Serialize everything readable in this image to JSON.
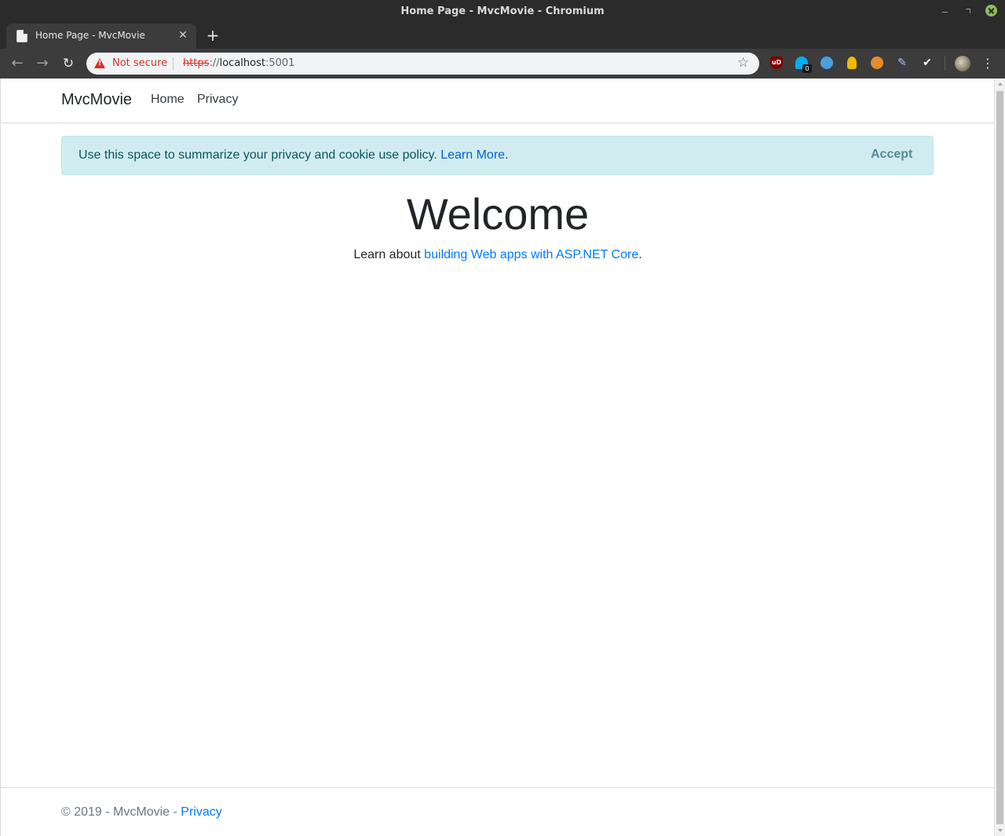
{
  "window": {
    "title": "Home Page - MvcMovie - Chromium"
  },
  "tab": {
    "title": "Home Page - MvcMovie",
    "close_glyph": "✕",
    "new_tab_glyph": "+"
  },
  "toolbar": {
    "back_glyph": "←",
    "forward_glyph": "→",
    "reload_glyph": "↻",
    "security_label": "Not secure",
    "url_scheme": "https",
    "url_sep": "://",
    "url_host": "localhost",
    "url_port": ":5001",
    "star_glyph": "☆",
    "menu_glyph": "⋮",
    "extensions": [
      {
        "name": "ublock",
        "label": "uD"
      },
      {
        "name": "ghostery",
        "label": "",
        "badge": "0"
      },
      {
        "name": "compass",
        "label": ""
      },
      {
        "name": "bulb",
        "label": ""
      },
      {
        "name": "cookie",
        "label": ""
      },
      {
        "name": "pen",
        "label": "✎"
      },
      {
        "name": "checkmark",
        "label": "✔"
      }
    ]
  },
  "site": {
    "brand": "MvcMovie",
    "nav": {
      "home": "Home",
      "privacy": "Privacy"
    },
    "cookie": {
      "text": "Use this space to summarize your privacy and cookie use policy. ",
      "link": "Learn More",
      "period": ".",
      "accept": "Accept"
    },
    "heading": "Welcome",
    "learn": {
      "prefix": "Learn about ",
      "link": "building Web apps with ASP.NET Core",
      "suffix": "."
    },
    "footer": {
      "text": "© 2019 - MvcMovie - ",
      "link": "Privacy"
    }
  },
  "colors": {
    "alert_bg": "#d1ecf1",
    "alert_text": "#0c5460",
    "link": "#007bff",
    "warning": "#d93025"
  }
}
